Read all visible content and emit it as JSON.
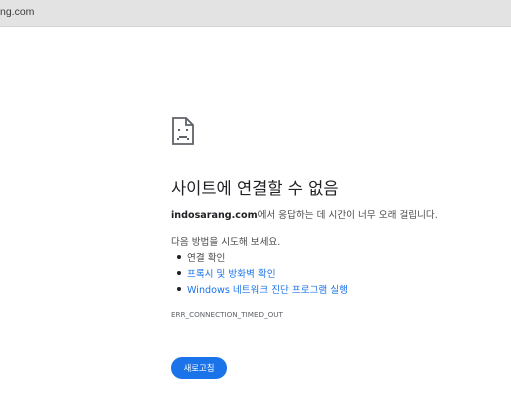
{
  "address_bar": {
    "url_text": "ng.com"
  },
  "error": {
    "icon": "sad-page-icon",
    "title": "사이트에 연결할 수 없음",
    "host": "indosarang.com",
    "message_suffix": "에서 응답하는 데 시간이 너무 오래 걸립니다.",
    "try_label": "다음 방법을 시도해 보세요.",
    "suggestions": [
      "연결 확인",
      "프록시 및 방화벽 확인",
      "Windows 네트워크 진단 프로그램 실행"
    ],
    "code": "ERR_CONNECTION_TIMED_OUT",
    "reload_label": "새로고침"
  },
  "colors": {
    "link": "#1a73e8",
    "button": "#1a73e8",
    "text": "#202124"
  }
}
